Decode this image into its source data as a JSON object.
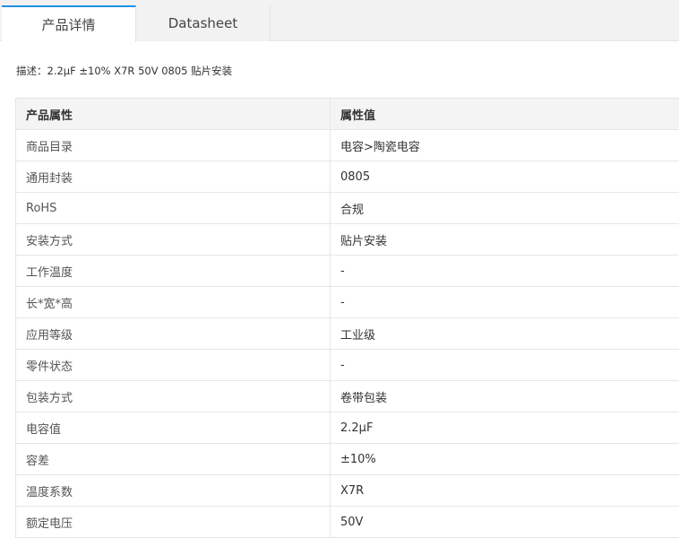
{
  "tabs": [
    {
      "label": "产品详情",
      "active": true
    },
    {
      "label": "Datasheet",
      "active": false
    }
  ],
  "description": {
    "label": "描述：",
    "value": "2.2μF ±10% X7R 50V 0805 贴片安装"
  },
  "table": {
    "headers": [
      "产品属性",
      "属性值"
    ],
    "rows": [
      [
        "商品目录",
        "电容>陶瓷电容"
      ],
      [
        "通用封装",
        "0805"
      ],
      [
        "RoHS",
        "合规"
      ],
      [
        "安装方式",
        "贴片安装"
      ],
      [
        "工作温度",
        "-"
      ],
      [
        "长*宽*高",
        "-"
      ],
      [
        "应用等级",
        "工业级"
      ],
      [
        "零件状态",
        "-"
      ],
      [
        "包装方式",
        "卷带包装"
      ],
      [
        "电容值",
        "2.2μF"
      ],
      [
        "容差",
        "±10%"
      ],
      [
        "温度系数",
        "X7R"
      ],
      [
        "额定电压",
        "50V"
      ]
    ]
  },
  "colors": {
    "accent": "#1e90e6",
    "tabbar_bg": "#f2f2f2",
    "header_bg": "#f4f4f4",
    "border": "#e6e6e6"
  }
}
